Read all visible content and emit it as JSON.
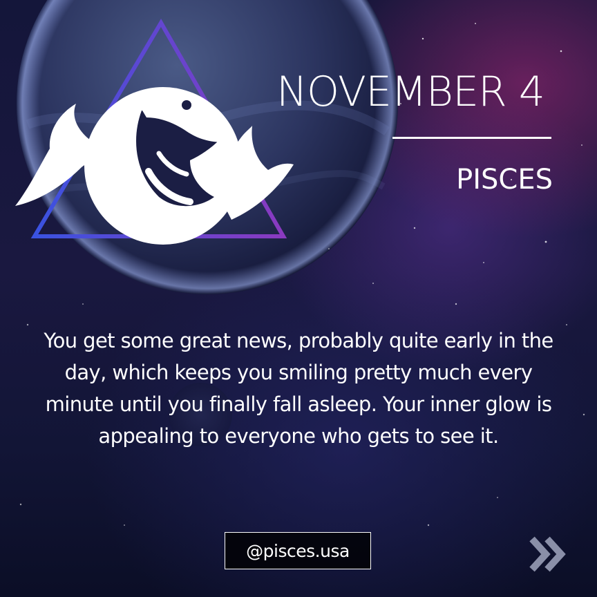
{
  "date": {
    "title": "NOVEMBER 4"
  },
  "zodiac": {
    "sign": "PISCES",
    "icon": "pisces-fish-icon"
  },
  "horoscope": {
    "text": "You get some great news, probably quite early in the day, which keeps you smiling pretty much every minute until you finally fall asleep. Your inner glow is appealing to everyone who gets to see it."
  },
  "footer": {
    "handle": "@pisces.usa",
    "next_icon": "double-chevron-right-icon"
  },
  "colors": {
    "text": "#ffffff",
    "triangle_start": "#3a52e0",
    "triangle_end": "#8a3ac0",
    "next_icon": "#8a8fa8"
  }
}
